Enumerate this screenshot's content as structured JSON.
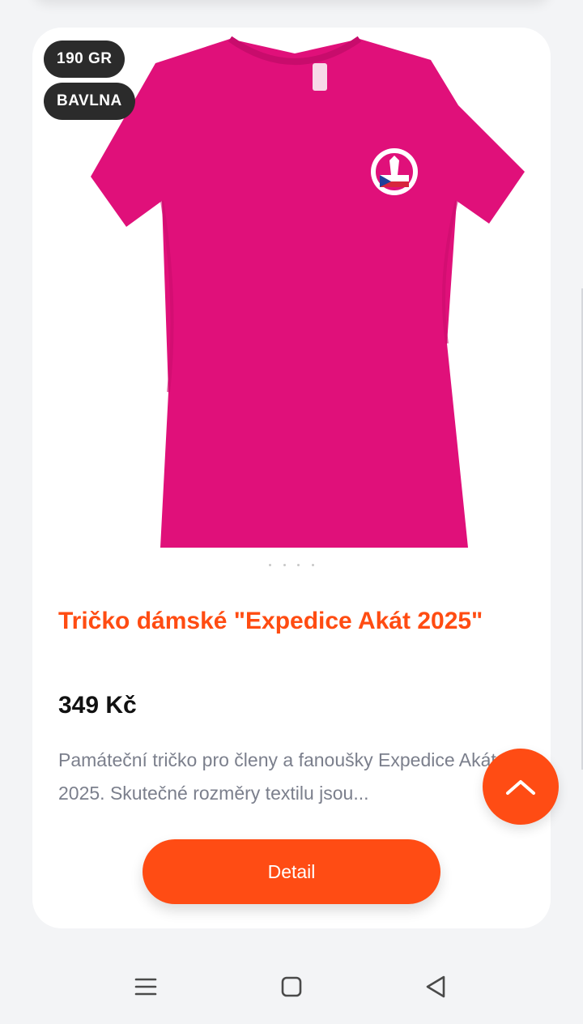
{
  "product": {
    "badges": [
      "190 GR",
      "BAVLNA"
    ],
    "title": "Tričko dámské \"Expedice Akát 2025\"",
    "price": "349 Kč",
    "description": "Památeční tričko pro členy a fanoušky Expedice Akát 2025. Skutečné rozměry textilu jsou...",
    "description_lines": [
      "Památeční tričko pro členy a fanoušky Expedice Akát",
      "2025. Skutečné rozměry textilu jsou..."
    ],
    "detail_label": "Detail",
    "image_carousel": {
      "count": 4,
      "active_index": 0
    },
    "image_icon": "pink-t-shirt-image"
  },
  "colors": {
    "accent": "#ff4c14",
    "title": "#ff4c12",
    "badge_background": "#2b2b2b",
    "shirt": "#e0107a",
    "description": "#7b7f8c",
    "page_background": "#f3f4f6"
  },
  "icons": {
    "scroll_top": "chevron-up-icon",
    "nav_menu": "menu-icon",
    "nav_home": "home-square-icon",
    "nav_back": "back-triangle-icon"
  }
}
